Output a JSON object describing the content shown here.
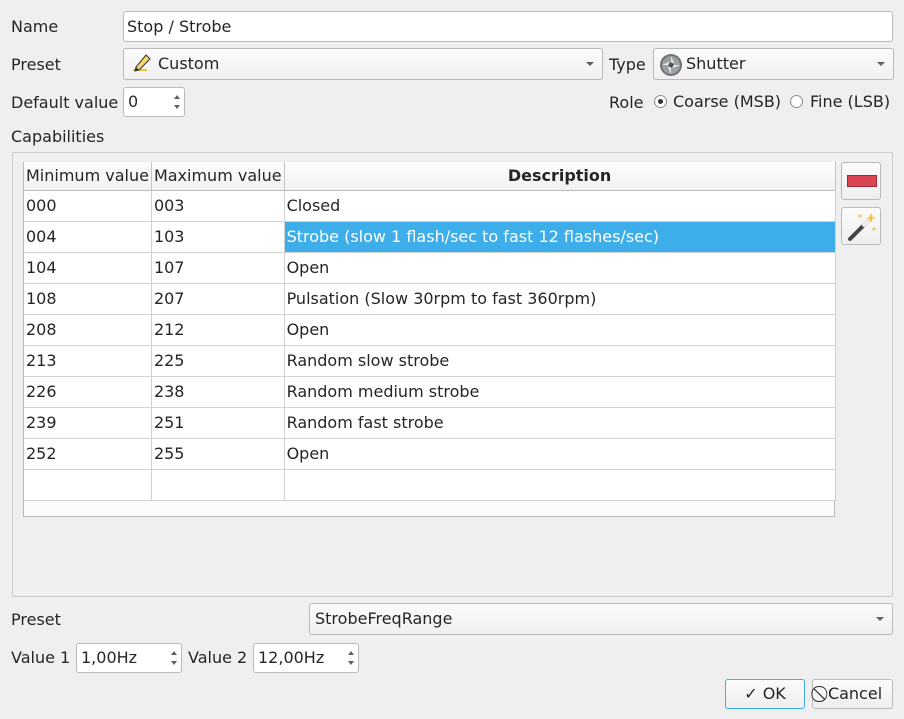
{
  "name": {
    "label": "Name",
    "value": "Stop / Strobe"
  },
  "preset": {
    "label": "Preset",
    "value": "Custom",
    "icon": "pencil-icon"
  },
  "type": {
    "label": "Type",
    "value": "Shutter",
    "icon": "shutter-icon"
  },
  "default_value": {
    "label": "Default value",
    "value": "0"
  },
  "role": {
    "label": "Role",
    "options": [
      {
        "label": "Coarse (MSB)",
        "checked": true
      },
      {
        "label": "Fine (LSB)",
        "checked": false
      }
    ]
  },
  "capabilities": {
    "label": "Capabilities",
    "columns": [
      "Minimum value",
      "Maximum value",
      "Description"
    ],
    "rows": [
      {
        "min": "000",
        "max": "003",
        "desc": "Closed",
        "selected": false
      },
      {
        "min": "004",
        "max": "103",
        "desc": "Strobe (slow 1 flash/sec to fast 12 flashes/sec)",
        "selected": true
      },
      {
        "min": "104",
        "max": "107",
        "desc": "Open",
        "selected": false
      },
      {
        "min": "108",
        "max": "207",
        "desc": "Pulsation (Slow 30rpm to fast 360rpm)",
        "selected": false
      },
      {
        "min": "208",
        "max": "212",
        "desc": "Open",
        "selected": false
      },
      {
        "min": "213",
        "max": "225",
        "desc": "Random slow strobe",
        "selected": false
      },
      {
        "min": "226",
        "max": "238",
        "desc": "Random medium strobe",
        "selected": false
      },
      {
        "min": "239",
        "max": "251",
        "desc": "Random fast strobe",
        "selected": false
      },
      {
        "min": "252",
        "max": "255",
        "desc": "Open",
        "selected": false
      },
      {
        "min": "",
        "max": "",
        "desc": "",
        "selected": false
      }
    ],
    "remove_icon": "remove-icon",
    "wizard_icon": "magic-wand-icon",
    "selection_color": "#3daee9",
    "remove_color": "#da4453"
  },
  "cap_preset": {
    "label": "Preset",
    "value": "StrobeFreqRange"
  },
  "value1": {
    "label": "Value 1",
    "value": "1,00Hz"
  },
  "value2": {
    "label": "Value 2",
    "value": "12,00Hz"
  },
  "buttons": {
    "ok": "OK",
    "cancel": "Cancel",
    "ok_icon": "check-icon",
    "cancel_icon": "cancel-icon"
  }
}
